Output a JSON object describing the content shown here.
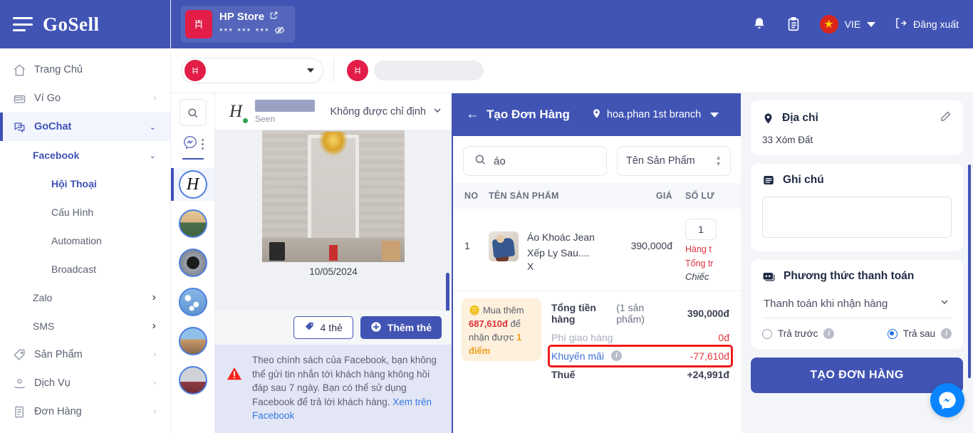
{
  "brand": {
    "name": "GoSell",
    "accent": "#4154b4",
    "red": "#e11d48"
  },
  "sidebar": {
    "items": [
      {
        "label": "Trang Chủ",
        "icon": "home-icon",
        "chevron": "",
        "level": 1
      },
      {
        "label": "Ví Go",
        "icon": "wallet-icon",
        "chevron": "›",
        "level": 1
      },
      {
        "label": "GoChat",
        "icon": "chat-icon",
        "chevron": "⌄",
        "level": 1,
        "active": true
      },
      {
        "label": "Facebook",
        "icon": "",
        "chevron": "⌄",
        "level": 2,
        "highlight": true
      },
      {
        "label": "Hội Thoại",
        "icon": "",
        "chevron": "",
        "level": 3,
        "highlight": true
      },
      {
        "label": "Cấu Hình",
        "icon": "",
        "chevron": "",
        "level": 3
      },
      {
        "label": "Automation",
        "icon": "",
        "chevron": "",
        "level": 3
      },
      {
        "label": "Broadcast",
        "icon": "",
        "chevron": "",
        "level": 3
      },
      {
        "label": "Zalo",
        "icon": "",
        "chevron": "›",
        "level": 2
      },
      {
        "label": "SMS",
        "icon": "",
        "chevron": "›",
        "level": 2
      },
      {
        "label": "Sản Phẩm",
        "icon": "tag-icon",
        "chevron": "›",
        "level": 1
      },
      {
        "label": "Dịch Vụ",
        "icon": "service-icon",
        "chevron": "›",
        "level": 1
      },
      {
        "label": "Đơn Hàng",
        "icon": "order-icon",
        "chevron": "›",
        "level": 1
      }
    ]
  },
  "topbar": {
    "store_name": "HP Store",
    "store_masked": "***  ***  ***",
    "external_icon": "external-link-icon",
    "eye_icon": "eye-off-icon",
    "bell_icon": "bell-icon",
    "clipboard_icon": "clipboard-icon",
    "lang_code": "VIE",
    "logout_label": "Đăng xuất",
    "logout_icon": "logout-icon"
  },
  "filterbar": {
    "page_select_value": "",
    "search_placeholder": ""
  },
  "chat": {
    "search_icon": "search-icon",
    "channel_icon": "messenger-icon",
    "more_icon": "more-vertical-icon",
    "avatar_letter": "H",
    "status": "Seen",
    "assign_label": "Không được chỉ định",
    "message_date": "10/05/2024",
    "tag_count_label": "4 thẻ",
    "tag_icon": "tag-icon",
    "add_tag_label": "Thêm thẻ",
    "add_icon": "plus-circle-icon",
    "warning_icon": "warning-triangle-icon",
    "warning_text": "Theo chính sách của Facebook, bạn không thể gửi tin nhắn tới khách hàng không hồi đáp sau 7 ngày. Bạn có thể sử dụng Facebook để trả lời khách hàng. ",
    "warning_link": "Xem trên Facebook"
  },
  "order": {
    "back_icon": "arrow-left-icon",
    "title": "Tạo Đơn Hàng",
    "branch_icon": "location-pin-icon",
    "branch": "hoa.phan 1st branch",
    "search_value": "áo",
    "search_icon": "search-icon",
    "sort_value": "Tên Sản Phẩm",
    "table": {
      "columns": [
        "NO",
        "TÊN SẢN PHẨM",
        "GIÁ",
        "SỐ LƯ"
      ],
      "rows": [
        {
          "no": "1",
          "name": "Áo Khoác Jean Xếp Ly Sau....",
          "variant": "X",
          "price": "390,000đ",
          "qty": "1",
          "stock_warn": "Hàng t",
          "total_warn": "Tổng tr",
          "unit": "Chiếc"
        }
      ]
    },
    "promo": {
      "icon": "coin-icon",
      "prefix": "Mua thêm ",
      "amount": "687,610đ",
      "middle": " để nhận được ",
      "points": "1",
      "suffix": " điểm"
    },
    "totals": [
      {
        "label": "Tổng tiền hàng",
        "sub": "(1 sản phẩm)",
        "value": "390,000đ",
        "style": "bold"
      },
      {
        "label": "Phí giao hàng",
        "sub": "",
        "value": "0đ",
        "style": "muted-red"
      },
      {
        "label": "Khuyến mãi",
        "sub": "",
        "value": "-77,610đ",
        "style": "link-red",
        "info": true,
        "highlighted": true
      },
      {
        "label": "Thuế",
        "sub": "",
        "value": "+24,991đ",
        "style": "bold"
      }
    ]
  },
  "rightpanel": {
    "address": {
      "icon": "location-pin-icon",
      "title": "Địa chỉ",
      "edit_icon": "pencil-icon",
      "value": "33 Xóm Đất"
    },
    "note": {
      "icon": "note-icon",
      "title": "Ghi chú",
      "value": "",
      "placeholder": ""
    },
    "payment": {
      "icon": "payment-icon",
      "title": "Phương thức thanh toán",
      "selected": "Thanh toán khi nhận hàng",
      "options": [
        {
          "label": "Trả trước",
          "selected": false
        },
        {
          "label": "Trả sau",
          "selected": true
        }
      ]
    },
    "create_button": "TẠO ĐƠN HÀNG",
    "fab_icon": "messenger-icon"
  }
}
